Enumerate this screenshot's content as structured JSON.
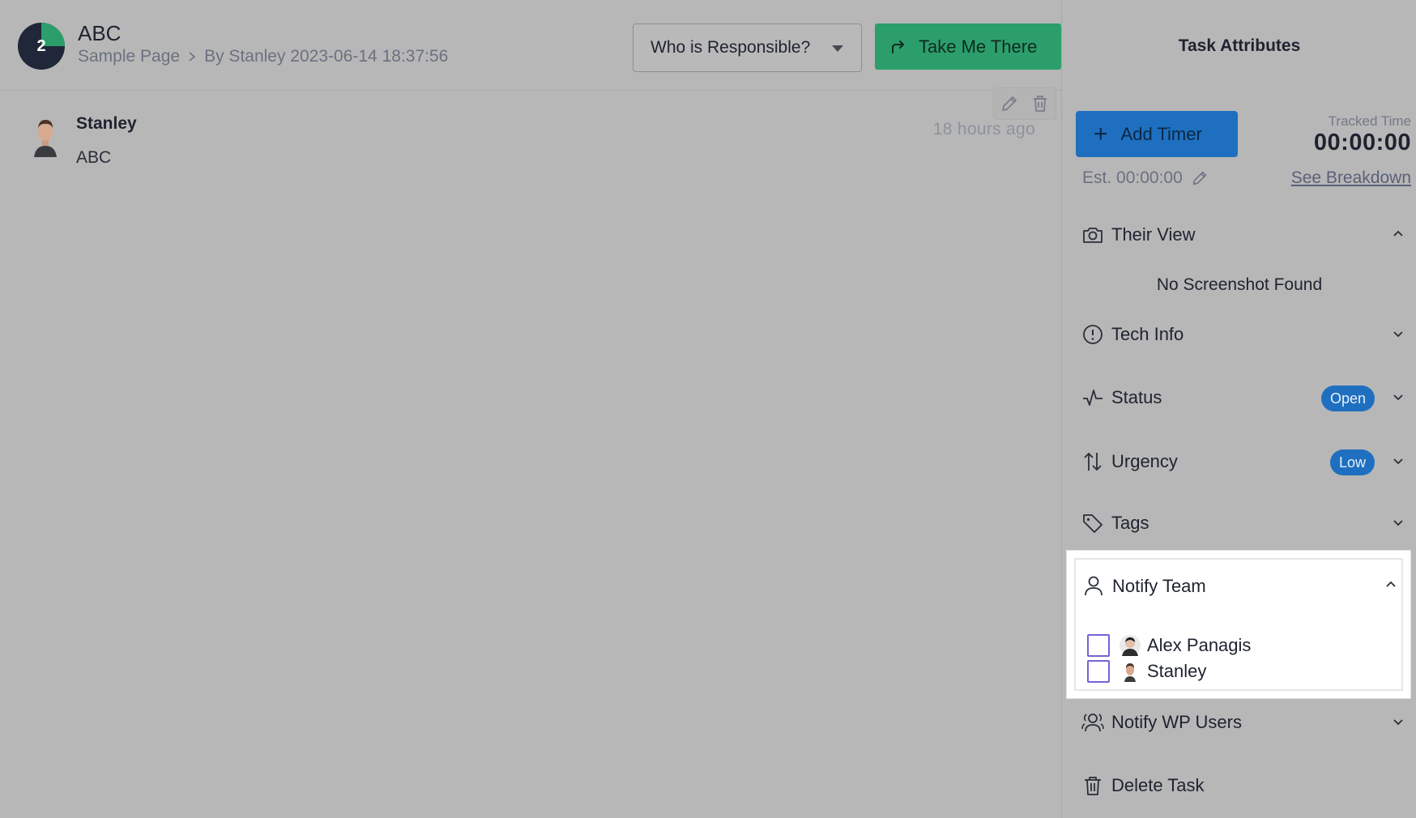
{
  "header": {
    "task_number": "2",
    "task_title": "ABC",
    "page_name": "Sample Page",
    "author_line": "By Stanley 2023-06-14 18:37:56",
    "responsible_label": "Who is Responsible?",
    "take_me_label": "Take Me There"
  },
  "comment": {
    "author": "Stanley",
    "text": "ABC",
    "time": "18 hours ago"
  },
  "sidebar": {
    "title": "Task Attributes",
    "add_timer_label": "Add Timer",
    "tracked_label": "Tracked Time",
    "tracked_value": "00:00:00",
    "estimate": "Est. 00:00:00",
    "breakdown_label": "See Breakdown",
    "their_view": "Their View",
    "no_screenshot": "No Screenshot Found",
    "tech_info": "Tech Info",
    "status_label": "Status",
    "status_value": "Open",
    "urgency_label": "Urgency",
    "urgency_value": "Low",
    "tags_label": "Tags",
    "notify_team_label": "Notify Team",
    "team_members": [
      "Alex Panagis",
      "Stanley"
    ],
    "notify_wp_label": "Notify WP Users",
    "delete_label": "Delete Task"
  },
  "colors": {
    "accent_green": "#2b9e6b",
    "accent_blue": "#1e6fbf",
    "checkbox_purple": "#7563d6",
    "overlay_gray": "#b7b7b7"
  },
  "icons": [
    "pencil-icon",
    "trash-icon",
    "share-arrow-icon",
    "camera-icon",
    "alert-circle-icon",
    "activity-icon",
    "sort-arrows-icon",
    "tag-icon",
    "user-icon",
    "users-icon",
    "chevron-right-icon",
    "chevron-up-icon",
    "chevron-down-icon"
  ]
}
